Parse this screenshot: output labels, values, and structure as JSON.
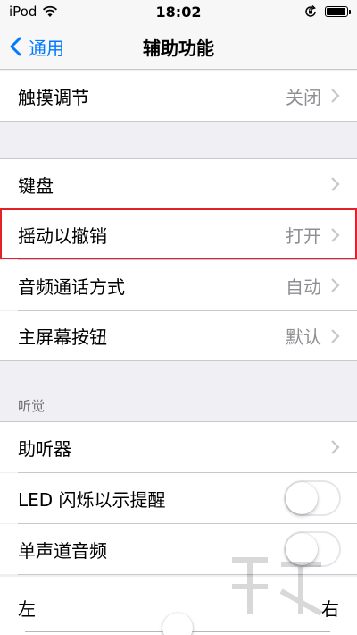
{
  "status_bar": {
    "carrier": "iPod",
    "time": "18:02",
    "battery_level": 0.95
  },
  "nav": {
    "back_label": "通用",
    "title": "辅助功能"
  },
  "rows": {
    "touch_adjust": {
      "label": "触摸调节",
      "value": "关闭"
    },
    "keyboard": {
      "label": "键盘"
    },
    "shake_undo": {
      "label": "摇动以撤销",
      "value": "打开"
    },
    "call_audio": {
      "label": "音频通话方式",
      "value": "自动"
    },
    "home_button": {
      "label": "主屏幕按钮",
      "value": "默认"
    }
  },
  "hearing": {
    "header": "听觉",
    "hearing_aids": {
      "label": "助听器"
    },
    "led_flash": {
      "label": "LED 闪烁以示提醒",
      "on": false
    },
    "mono_audio": {
      "label": "单声道音频",
      "on": false
    },
    "balance": {
      "left": "左",
      "right": "右",
      "value": 0.5
    }
  },
  "colors": {
    "accent": "#007aff",
    "highlight_border": "#e6202a",
    "secondary_text": "#8e8e93"
  }
}
